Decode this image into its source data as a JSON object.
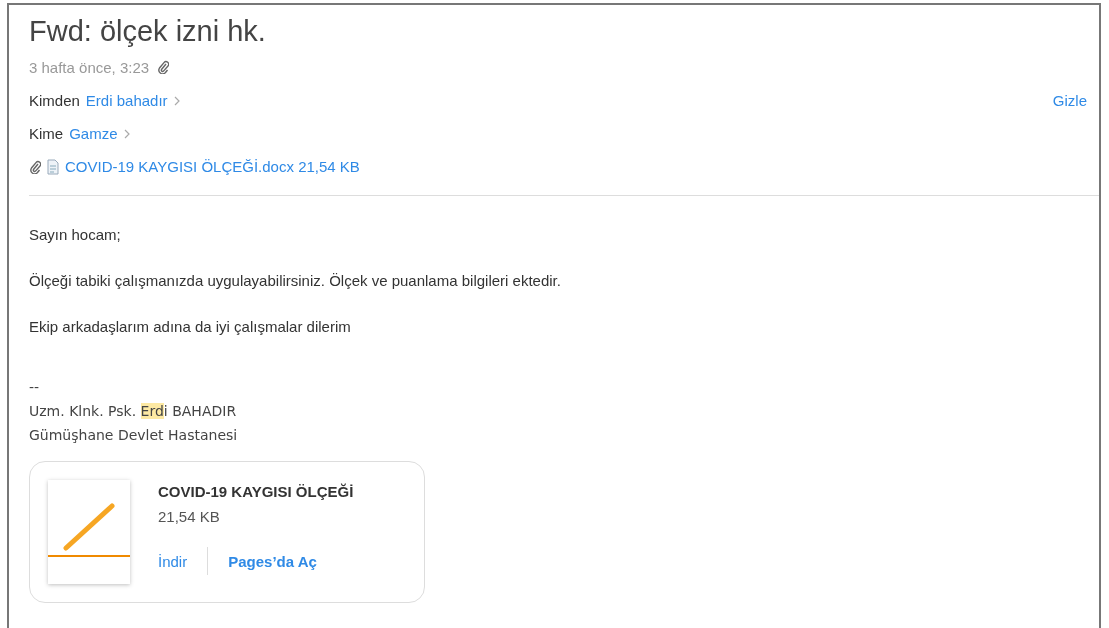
{
  "subject": "Fwd: ölçek izni hk.",
  "time": "3 hafta önce, 3:23",
  "has_attachment": true,
  "from": {
    "label": "Kimden",
    "name": "Erdi bahadır"
  },
  "hide_link": "Gizle",
  "to": {
    "label": "Kime",
    "name": "Gamze"
  },
  "attachment_line": "COVID-19 KAYGISI ÖLÇEĞİ.docx 21,54 KB",
  "body": [
    "Sayın hocam;",
    "Ölçeği tabiki çalışmanızda uygulayabilirsiniz. Ölçek ve puanlama bilgileri ektedir.",
    "Ekip arkadaşlarım adına da iyi çalışmalar dilerim"
  ],
  "signature": {
    "dashes": "--",
    "name_line": {
      "before": "Uzm. Klnk. Psk. ",
      "highlight": "Erd",
      "after": "i BAHADIR"
    },
    "org": "Gümüşhane Devlet Hastanesi"
  },
  "attachment_card": {
    "title": "COVID-19 KAYGISI ÖLÇEĞİ",
    "size": "21,54 KB",
    "actions": [
      "İndir",
      "Pages’da Aç"
    ]
  }
}
